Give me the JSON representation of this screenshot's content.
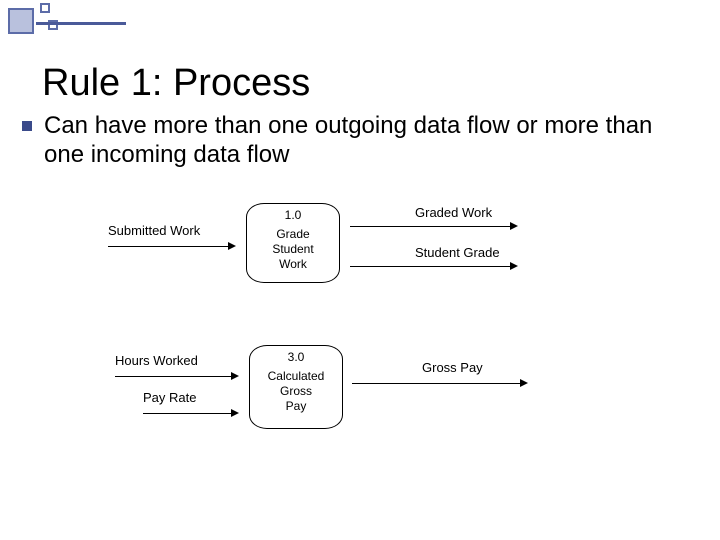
{
  "slide": {
    "title": "Rule 1: Process",
    "bullet": "Can have more than one outgoing data flow or more than one incoming data flow"
  },
  "diagram1": {
    "input1": "Submitted Work",
    "process_id": "1.0",
    "process_name": "Grade\nStudent\nWork",
    "output1": "Graded Work",
    "output2": "Student Grade"
  },
  "diagram2": {
    "input1": "Hours Worked",
    "input2": "Pay Rate",
    "process_id": "3.0",
    "process_name": "Calculated\nGross\nPay",
    "output1": "Gross Pay"
  }
}
